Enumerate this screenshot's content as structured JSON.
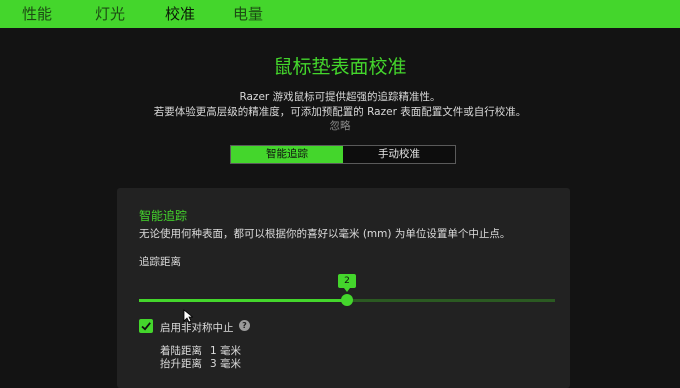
{
  "tabs": [
    {
      "label": "性能"
    },
    {
      "label": "灯光"
    },
    {
      "label": "校准",
      "active": true
    },
    {
      "label": "电量"
    }
  ],
  "header": {
    "title": "鼠标垫表面校准",
    "desc_line1": "Razer 游戏鼠标可提供超强的追踪精准性。",
    "desc_line2": "若要体验更高层级的精准度，可添加预配置的 Razer 表面配置文件或自行校准。",
    "ignore_link": "忽略"
  },
  "mode_toggle": {
    "options": [
      "智能追踪",
      "手动校准"
    ],
    "selected": "智能追踪"
  },
  "panel": {
    "title": "智能追踪",
    "description": "无论使用何种表面，都可以根据你的喜好以毫米 (mm) 为单位设置单个中止点。",
    "distance_label": "追踪距离",
    "slider": {
      "value": "2",
      "min": 1,
      "max": 10,
      "fraction": 0.5
    },
    "asymmetric_label": "启用非对称中止",
    "asymmetric_checked": true,
    "landing_label": "着陆距离",
    "landing_value": "1 毫米",
    "lift_label": "抬升距离",
    "lift_value": "3 毫米"
  },
  "colors": {
    "accent": "#44d62c",
    "background": "#131313",
    "panel": "#222222"
  }
}
